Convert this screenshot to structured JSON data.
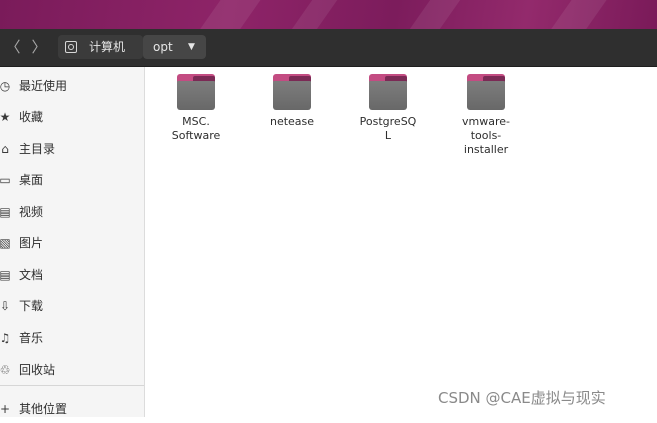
{
  "window": {
    "nav": {
      "back_icon": "chevron-left-icon",
      "forward_icon": "chevron-right-icon",
      "back_glyph": "〈",
      "forward_glyph": "〉"
    },
    "breadcrumb": [
      {
        "label": "计算机",
        "icon": "computer-drive-icon"
      },
      {
        "label": "opt",
        "icon": "caret-down-icon",
        "caret": "▼"
      }
    ]
  },
  "sidebar": {
    "items": [
      {
        "label": "最近使用",
        "icon": "clock-icon",
        "glyph": "◷"
      },
      {
        "label": "收藏",
        "icon": "star-icon",
        "glyph": "★"
      },
      {
        "label": "主目录",
        "icon": "home-icon",
        "glyph": "⌂"
      },
      {
        "label": "桌面",
        "icon": "desktop-icon",
        "glyph": "▭"
      },
      {
        "label": "视频",
        "icon": "video-icon",
        "glyph": "▤"
      },
      {
        "label": "图片",
        "icon": "image-icon",
        "glyph": "▧"
      },
      {
        "label": "文档",
        "icon": "document-icon",
        "glyph": "▤"
      },
      {
        "label": "下载",
        "icon": "download-icon",
        "glyph": "⇩"
      },
      {
        "label": "音乐",
        "icon": "music-icon",
        "glyph": "♫"
      },
      {
        "label": "回收站",
        "icon": "trash-icon",
        "glyph": "♲"
      }
    ],
    "other_locations": {
      "label": "其他位置",
      "icon": "plus-icon",
      "glyph": "+"
    }
  },
  "files": [
    {
      "name": "MSC.\nSoftware",
      "icon": "folder-icon"
    },
    {
      "name": "netease",
      "icon": "folder-icon"
    },
    {
      "name": "PostgreSQ\nL",
      "icon": "folder-icon"
    },
    {
      "name": "vmware-\ntools-\ninstaller",
      "icon": "folder-icon"
    }
  ],
  "watermark": "CSDN @CAE虚拟与现实",
  "colors": {
    "headerbar": "#2f2f2f",
    "sidebar": "#f5f5f5",
    "folder_tab": "#c34c82",
    "folder_body": "#6e6e6e",
    "wallpaper": "#7a1b5a"
  }
}
